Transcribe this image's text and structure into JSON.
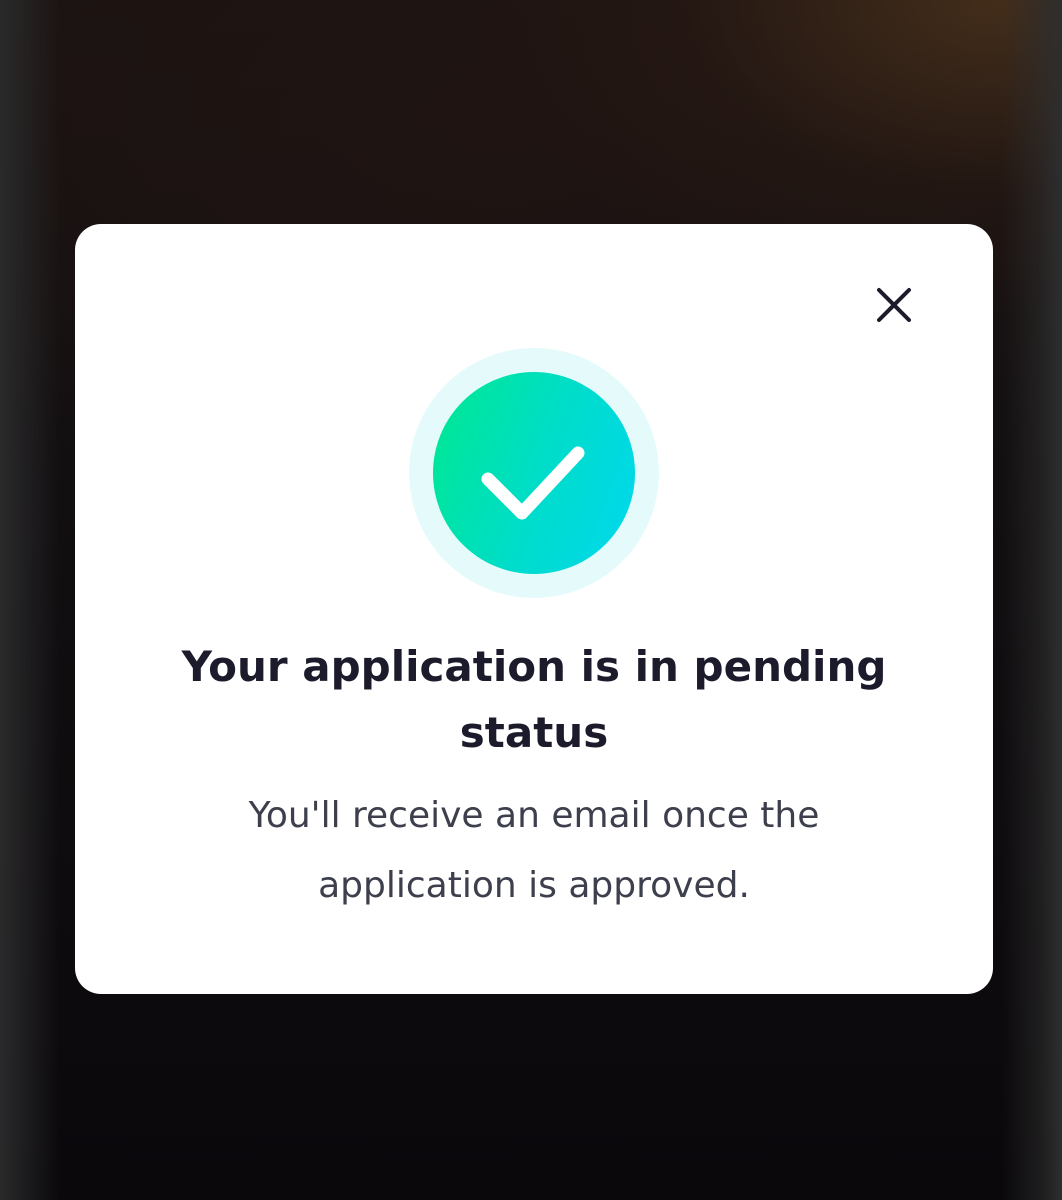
{
  "modal": {
    "title": "Your application is in pending status",
    "message": "You'll receive an email once the application is approved.",
    "close_icon": "close-icon",
    "status_icon": "checkmark-icon"
  },
  "colors": {
    "title": "#1b1b2c",
    "message": "#3d3f4c",
    "check_gradient_start": "#00e88f",
    "check_gradient_end": "#00d8f0",
    "check_halo": "#e5fbfb",
    "modal_background": "#ffffff"
  }
}
